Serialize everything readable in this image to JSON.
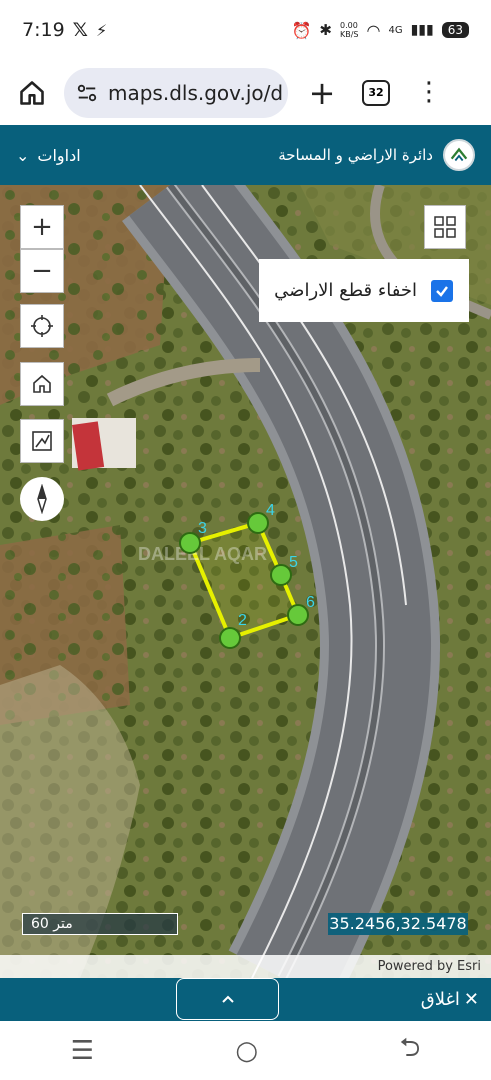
{
  "status": {
    "time": "7:19",
    "net_speed": "0.00\nKB/S",
    "signal": "4G",
    "battery": "63"
  },
  "browser": {
    "url": "maps.dls.gov.jo/d",
    "tab_count": "32"
  },
  "header": {
    "tools_label": "اداوات",
    "dept_name": "دائرة الاراضي و المساحة"
  },
  "map": {
    "hide_parcels_label": "اخفاء قطع الاراضي",
    "hide_parcels_checked": true,
    "watermark": "DALEEL AQAR",
    "markers": [
      "2",
      "3",
      "4",
      "5",
      "6"
    ],
    "scale_label": "60 متر",
    "coordinates": "35.2456,32.5478",
    "attribution": "Powered by Esri"
  },
  "bottom": {
    "close_label": "اغلاق"
  },
  "colors": {
    "header": "#08607c",
    "accent": "#1a73e8",
    "parcel": "#e6f000",
    "marker": "#66c93a",
    "label": "#3cd3e8"
  }
}
